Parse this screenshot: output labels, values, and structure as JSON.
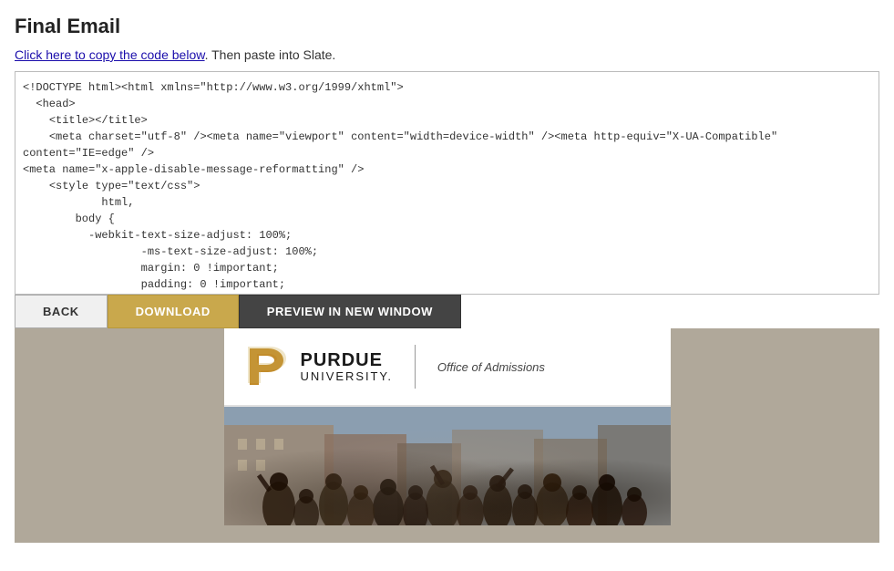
{
  "page": {
    "title": "Final Email",
    "copy_link_text": "Click here to copy the code below",
    "copy_link_suffix": ". Then paste into Slate.",
    "code_content": "<!DOCTYPE html><html xmlns=\"http://www.w3.org/1999/xhtml\">\n  <head>\n    <title></title>\n    <meta charset=\"utf-8\" /><meta name=\"viewport\" content=\"width=device-width\" /><meta http-equiv=\"X-UA-Compatible\" content=\"IE=edge\" />\n<meta name=\"x-apple-disable-message-reformatting\" />\n    <style type=\"text/css\">\n            html,\n        body {\n          -webkit-text-size-adjust: 100%;\n                  -ms-text-size-adjust: 100%;\n                  margin: 0 !important;\n                  padding: 0 !important;"
  },
  "toolbar": {
    "back_label": "BACK",
    "download_label": "DOWNLOAD",
    "preview_label": "PREVIEW IN NEW WINDOW"
  },
  "preview": {
    "university_name": "PURDUE",
    "university_word": "UNIVERSITY.",
    "office_name": "Office of Admissions"
  }
}
